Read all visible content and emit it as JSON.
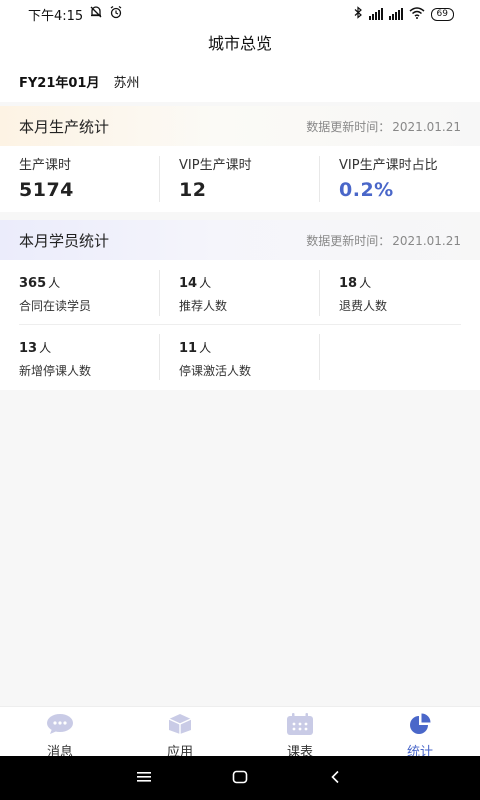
{
  "status": {
    "time": "下午4:15",
    "battery": "69"
  },
  "header": {
    "title": "城市总览"
  },
  "filter": {
    "date": "FY21年01月",
    "city": "苏州"
  },
  "production": {
    "title": "本月生产统计",
    "update_label": "数据更新时间：",
    "update_date": "2021.01.21",
    "stats": [
      {
        "label": "生产课时",
        "value": "5174"
      },
      {
        "label": "VIP生产课时",
        "value": "12"
      },
      {
        "label": "VIP生产课时占比",
        "value": "0.2%"
      }
    ],
    "accent_color": "#4a67c9"
  },
  "students": {
    "title": "本月学员统计",
    "update_label": "数据更新时间：",
    "update_date": "2021.01.21",
    "unit": "人",
    "stats": [
      {
        "value": "365",
        "label": "合同在读学员"
      },
      {
        "value": "14",
        "label": "推荐人数"
      },
      {
        "value": "18",
        "label": "退费人数"
      },
      {
        "value": "13",
        "label": "新增停课人数"
      },
      {
        "value": "11",
        "label": "停课激活人数"
      }
    ]
  },
  "tabs": [
    {
      "label": "消息",
      "icon": "message-icon"
    },
    {
      "label": "应用",
      "icon": "app-cube-icon"
    },
    {
      "label": "课表",
      "icon": "calendar-icon"
    },
    {
      "label": "统计",
      "icon": "pie-chart-icon",
      "active": true
    }
  ],
  "colors": {
    "active": "#4a67c9",
    "inactive_icon": "#c9cbe6"
  }
}
